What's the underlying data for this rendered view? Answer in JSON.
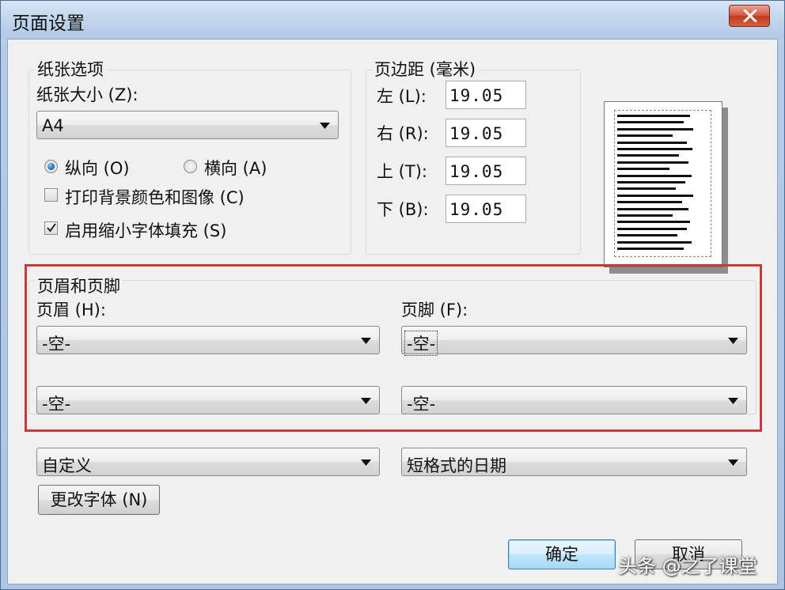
{
  "window": {
    "title": "页面设置"
  },
  "paper": {
    "group_label": "纸张选项",
    "size_label": "纸张大小 (Z):",
    "size_value": "A4",
    "portrait_label": "纵向 (O)",
    "landscape_label": "横向 (A)",
    "print_background_label": "打印背景颜色和图像 (C)",
    "shrink_to_fit_label": "启用缩小字体填充 (S)",
    "orientation_selected": "portrait",
    "print_background_checked": false,
    "shrink_to_fit_checked": true
  },
  "margins": {
    "group_label": "页边距 (毫米)",
    "left_label": "左 (L):",
    "left_value": "19.05",
    "right_label": "右 (R):",
    "right_value": "19.05",
    "top_label": "上 (T):",
    "top_value": "19.05",
    "bottom_label": "下 (B):",
    "bottom_value": "19.05"
  },
  "header_footer": {
    "group_label": "页眉和页脚",
    "header_label": "页眉 (H):",
    "footer_label": "页脚 (F):",
    "header_value_1": "-空-",
    "header_value_2": "-空-",
    "header_value_3": "自定义",
    "footer_value_1": "-空-",
    "footer_value_2": "-空-",
    "footer_value_3": "短格式的日期",
    "change_font_label": "更改字体 (N)"
  },
  "actions": {
    "ok_label": "确定",
    "cancel_label": "取消"
  },
  "watermark": "头条 @之了课堂",
  "colors": {
    "highlight_border": "#c83a3a",
    "close_button": "#c0391f",
    "dialog_background": "#f0f0f0"
  }
}
